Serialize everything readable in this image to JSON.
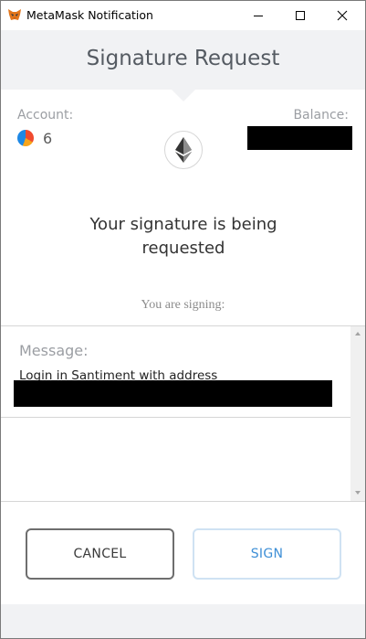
{
  "window": {
    "title": "MetaMask Notification",
    "icon": "metamask-fox-icon"
  },
  "header": {
    "title": "Signature Request"
  },
  "account": {
    "label": "Account:",
    "name": "6"
  },
  "balance": {
    "label": "Balance:"
  },
  "network_icon": "ethereum-icon",
  "heading": {
    "line1": "Your signature is being",
    "line2": "requested"
  },
  "signing_label": "You are signing:",
  "message": {
    "label": "Message:",
    "text": "Login in Santiment with address"
  },
  "buttons": {
    "cancel": "CANCEL",
    "sign": "SIGN"
  },
  "colors": {
    "header_bg": "#f1f2f4",
    "sign_text": "#3e8fd6",
    "sign_border": "#cfe2f3"
  }
}
